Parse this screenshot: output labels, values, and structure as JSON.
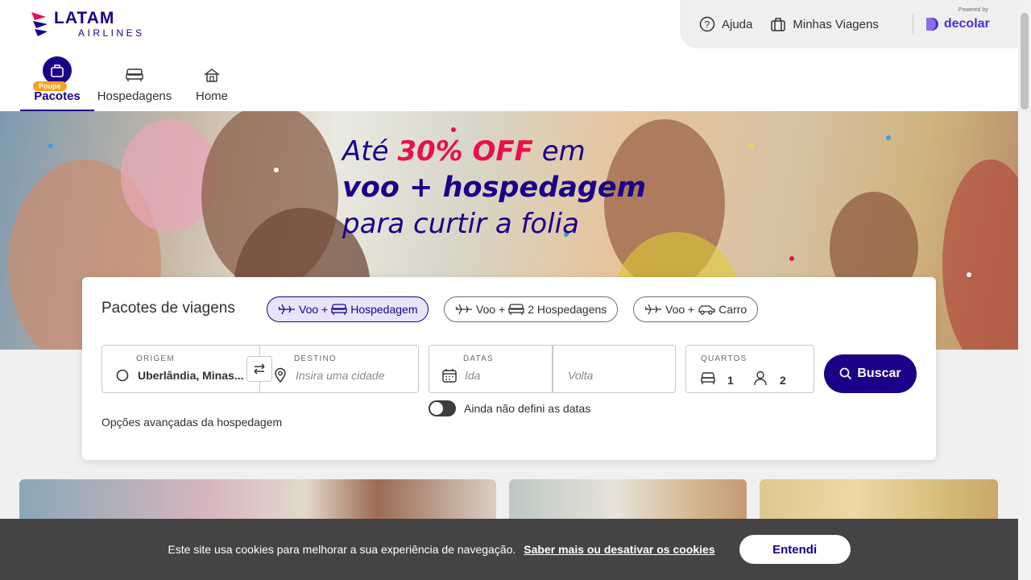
{
  "brand": {
    "name": "LATAM",
    "sub": "AIRLINES"
  },
  "utility": {
    "help_label": "Ajuda",
    "trips_label": "Minhas Viagens",
    "powered_by": "Powered by",
    "partner": "decolar"
  },
  "tabs": [
    {
      "label": "Pacotes",
      "badge": "Poupe",
      "active": true
    },
    {
      "label": "Hospedagens"
    },
    {
      "label": "Home"
    }
  ],
  "hero": {
    "line1_pre": "Até ",
    "line1_highlight": "30% OFF",
    "line1_post": " em",
    "line2": "voo + hospedagem",
    "line3": "para curtir a folia"
  },
  "search": {
    "title": "Pacotes de viagens",
    "chips": [
      {
        "prefix": "Voo +",
        "label": "Hospedagem",
        "active": true
      },
      {
        "prefix": "Voo +",
        "label": "2 Hospedagens"
      },
      {
        "prefix": "Voo +",
        "label": "Carro"
      }
    ],
    "origin": {
      "label": "ORIGEM",
      "value": "Uberlândia, Minas..."
    },
    "destination": {
      "label": "DESTINO",
      "placeholder": "Insira uma cidade"
    },
    "dates": {
      "label": "DATAS",
      "depart_placeholder": "Ida",
      "return_placeholder": "Volta"
    },
    "rooms": {
      "label": "QUARTOS",
      "rooms": "1",
      "people": "2"
    },
    "button": "Buscar",
    "toggle_label": "Ainda não defini as datas",
    "advanced": "Opções avançadas da hospedagem"
  },
  "cookie": {
    "text": "Este site usa cookies para melhorar a sua experiência de navegação.",
    "link": "Saber mais ou desativar os cookies",
    "button": "Entendi"
  },
  "colors": {
    "brand": "#1b0088",
    "accent": "#e8114b",
    "badge": "#f7a21b",
    "partner": "#4b2bd6"
  }
}
